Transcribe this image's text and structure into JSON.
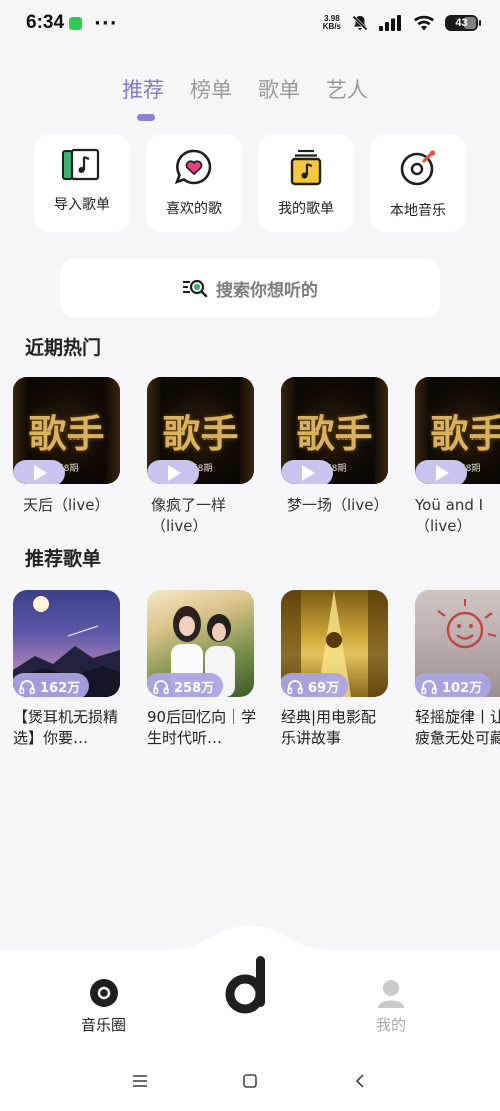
{
  "status_bar": {
    "time": "6:34",
    "dots": "···",
    "speed_value": "3.98",
    "speed_unit": "KB/s",
    "battery": "43"
  },
  "tabs": [
    {
      "label": "推荐",
      "active": true
    },
    {
      "label": "榜单",
      "active": false
    },
    {
      "label": "歌单",
      "active": false
    },
    {
      "label": "艺人",
      "active": false
    }
  ],
  "quick_actions": [
    {
      "label": "导入歌单",
      "icon": "import-playlist-icon"
    },
    {
      "label": "喜欢的歌",
      "icon": "heart-bubble-icon"
    },
    {
      "label": "我的歌单",
      "icon": "my-playlist-icon"
    },
    {
      "label": "本地音乐",
      "icon": "vinyl-record-icon"
    }
  ],
  "search": {
    "placeholder": "搜索你想听的"
  },
  "recent_hot": {
    "title": "近期热门",
    "cover_title": "歌手",
    "cover_year": "2025",
    "cover_episode": "第8期",
    "items": [
      {
        "title": "天后（live）"
      },
      {
        "title": "像疯了一样（live）"
      },
      {
        "title": "梦一场（live）"
      },
      {
        "title": "Yoü and I（live）"
      }
    ]
  },
  "recommended_playlists": {
    "title": "推荐歌单",
    "items": [
      {
        "title": "【煲耳机无损精选】你要…",
        "plays": "162万"
      },
      {
        "title": "90后回忆向｜学生时代听…",
        "plays": "258万"
      },
      {
        "title": "经典|用电影配乐讲故事",
        "plays": "69万"
      },
      {
        "title": "轻摇旋律丨让疲惫无处可藏",
        "plays": "102万"
      }
    ]
  },
  "bottom_nav": {
    "left": {
      "label": "音乐圈"
    },
    "right": {
      "label": "我的"
    }
  },
  "colors": {
    "accent": "#8477cf",
    "pill": "#c9c3ee",
    "background": "#f6f6f8"
  }
}
